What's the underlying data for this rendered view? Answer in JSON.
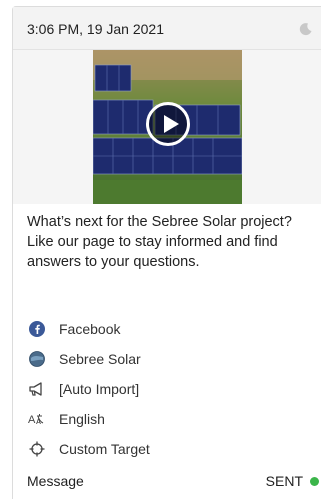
{
  "post": {
    "timestamp": "3:06 PM, 19 Jan 2021",
    "message": "What’s next for the Sebree Solar project? Like our page to stay informed and find answers to your questions.",
    "meta": [
      {
        "icon": "facebook-icon",
        "label": "Facebook"
      },
      {
        "icon": "globe-icon",
        "label": "Sebree Solar"
      },
      {
        "icon": "megaphone-icon",
        "label": "[Auto Import]"
      },
      {
        "icon": "language-icon",
        "label": "English"
      },
      {
        "icon": "target-icon",
        "label": "Custom Target"
      }
    ],
    "footer": {
      "type_label": "Message",
      "status_label": "SENT",
      "status_color": "#3bb54a"
    }
  },
  "colors": {
    "header_bg": "#f3f3f3",
    "facebook_blue": "#3b5998"
  }
}
